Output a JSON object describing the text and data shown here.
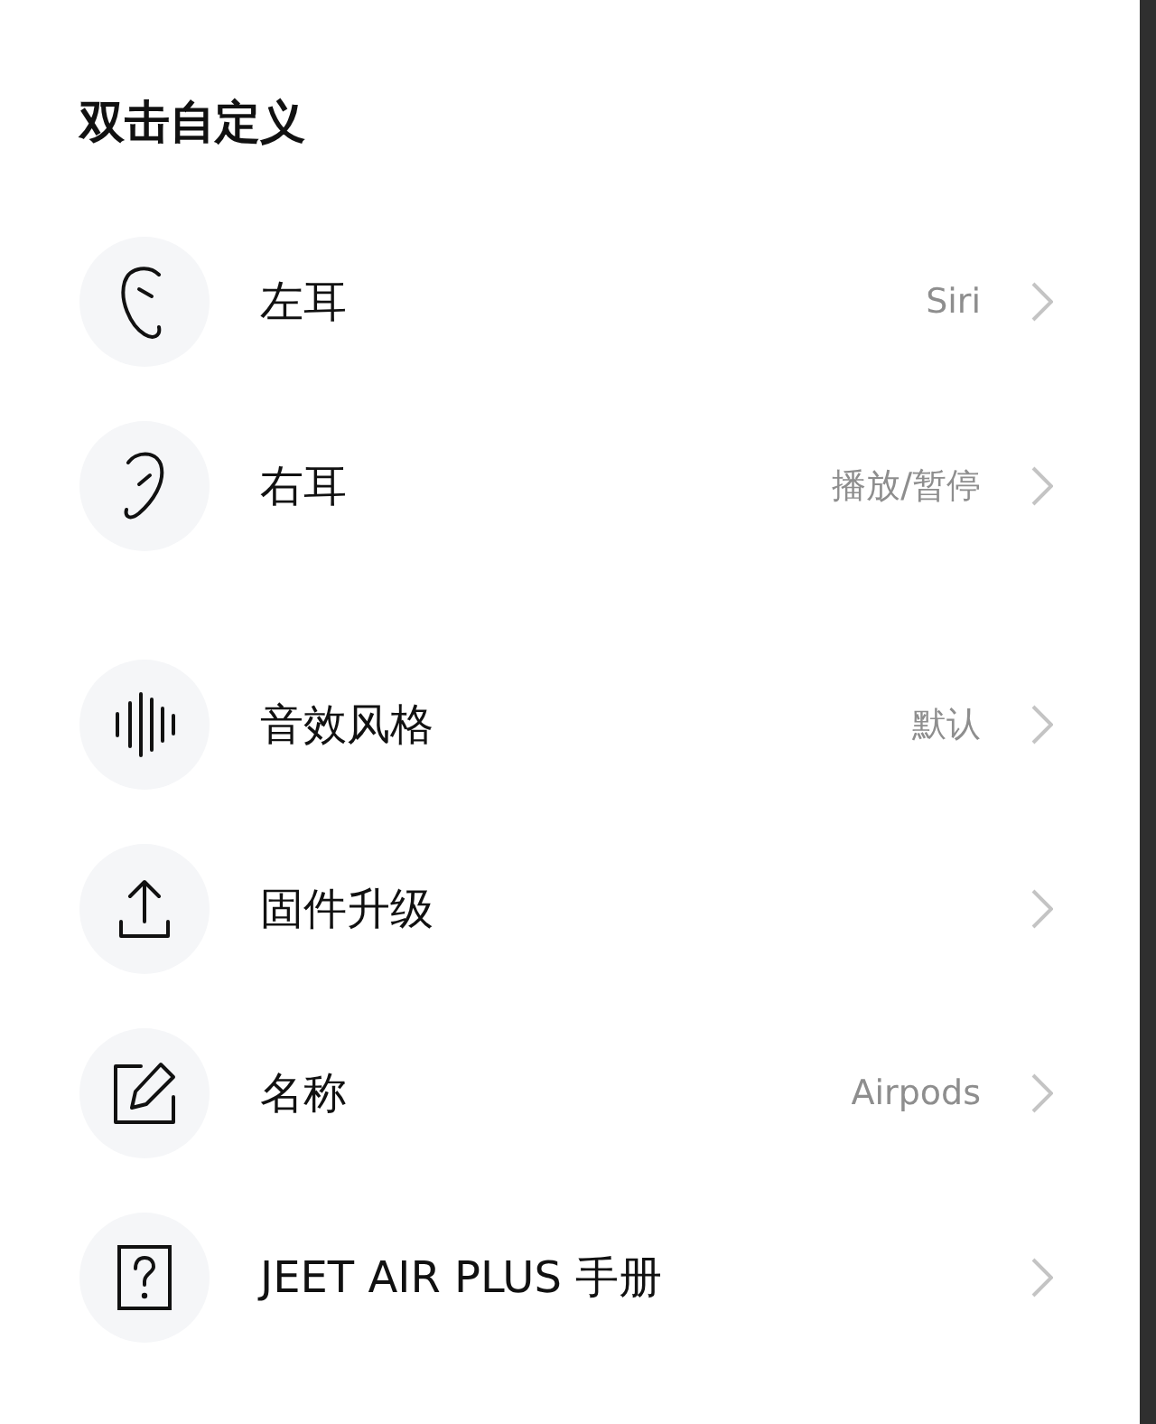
{
  "title": "双击自定义",
  "groups": [
    {
      "items": [
        {
          "kind": "left-ear",
          "label": "左耳",
          "value": "Siri"
        },
        {
          "kind": "right-ear",
          "label": "右耳",
          "value": "播放/暂停"
        }
      ]
    },
    {
      "items": [
        {
          "kind": "sound",
          "label": "音效风格",
          "value": "默认"
        },
        {
          "kind": "upload",
          "label": "固件升级"
        },
        {
          "kind": "edit",
          "label": "名称",
          "value": "Airpods"
        },
        {
          "kind": "help",
          "label": "JEET AIR PLUS 手册"
        }
      ]
    }
  ]
}
